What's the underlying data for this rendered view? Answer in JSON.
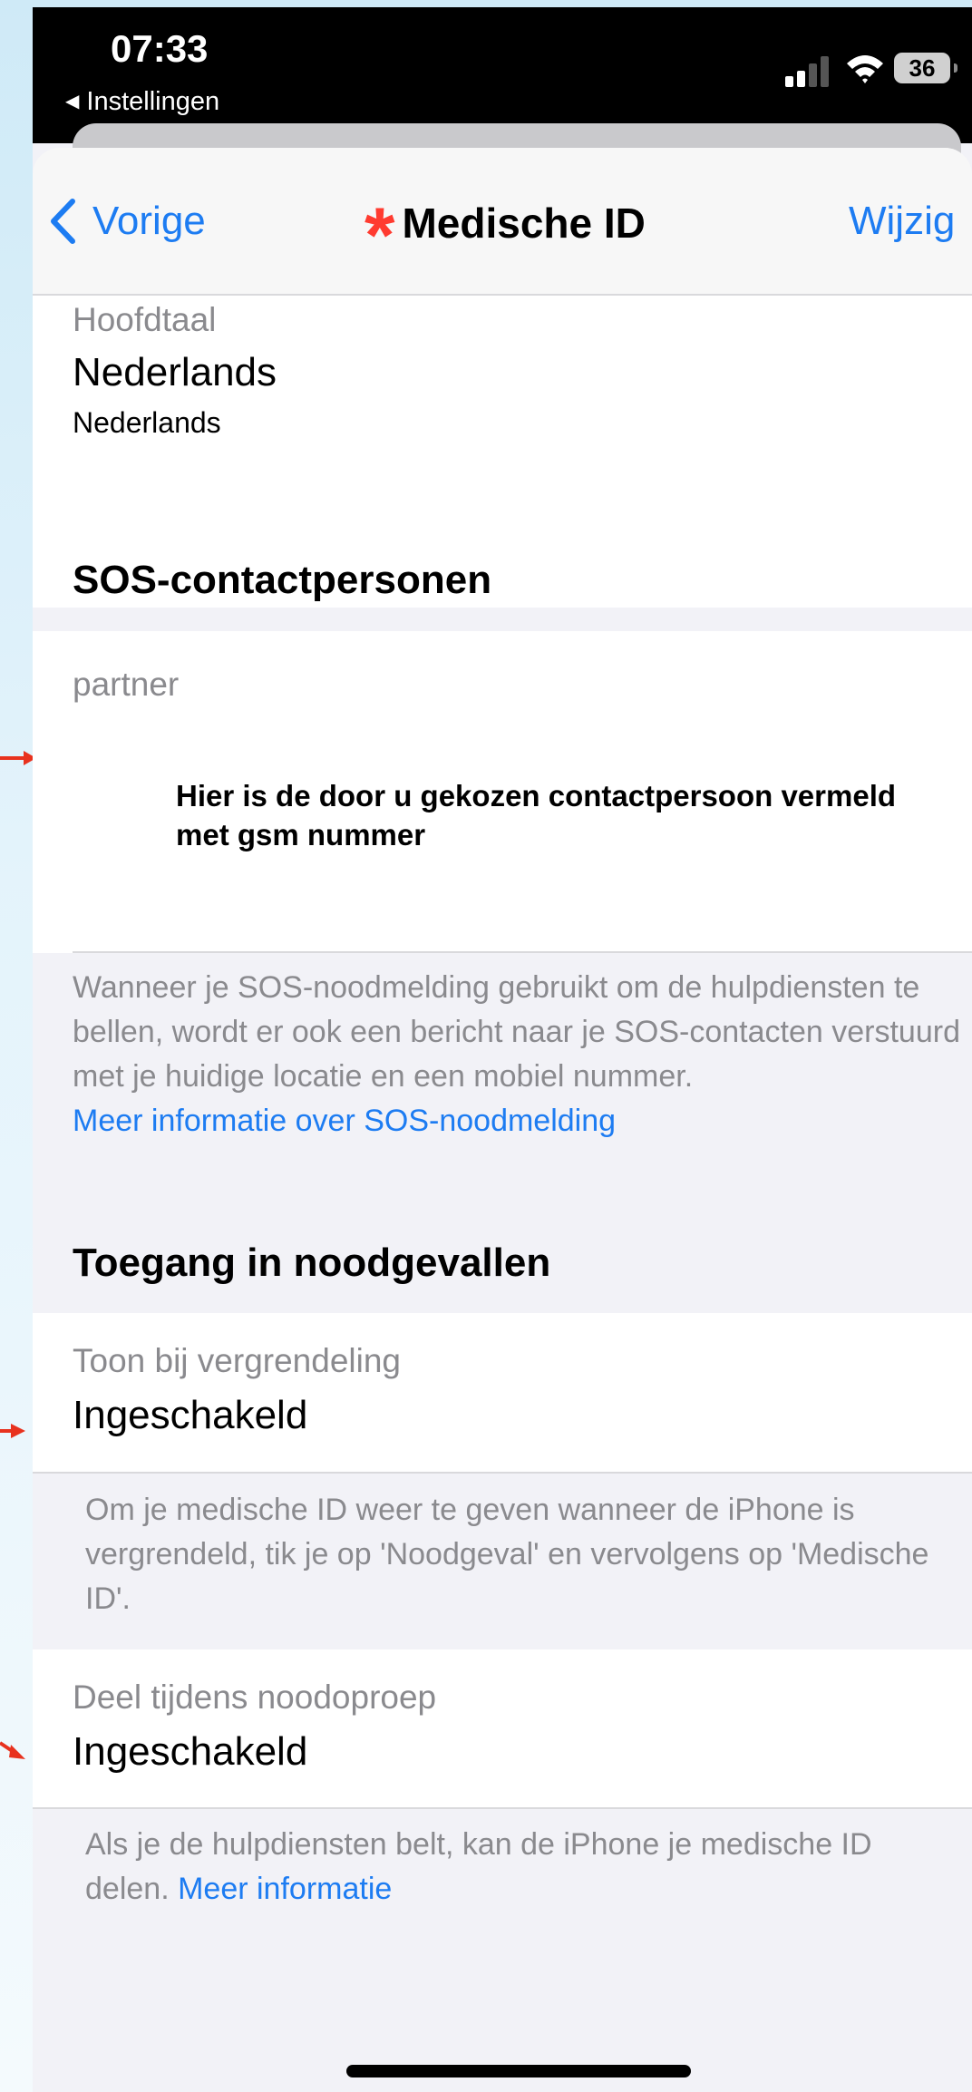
{
  "status_bar": {
    "time": "07:33",
    "back_app": "Instellingen",
    "battery": "36"
  },
  "nav": {
    "back_label": "Vorige",
    "title": "Medische ID",
    "edit_label": "Wijzig"
  },
  "language": {
    "label": "Hoofdtaal",
    "value": "Nederlands",
    "subvalue": "Nederlands"
  },
  "sos": {
    "header": "SOS-contactpersonen",
    "contact_relation": "partner",
    "annotation": "Hier is de door u gekozen contactpersoon vermeld met gsm nummer",
    "footer_text": "Wanneer je SOS-noodmelding gebruikt om de hulpdiensten te bellen, wordt er ook een bericht naar je SOS-contacten verstuurd met je huidige locatie en een mobiel nummer.",
    "footer_link": "Meer informatie over SOS-noodmelding"
  },
  "emergency_access": {
    "header": "Toegang in noodgevallen",
    "lock_label": "Toon bij vergrendeling",
    "lock_value": "Ingeschakeld",
    "lock_footer": "Om je medische ID weer te geven wanneer de iPhone is vergrendeld, tik je op 'Noodgeval' en vervolgens op 'Medische ID'.",
    "share_label": "Deel tijdens noodoproep",
    "share_value": "Ingeschakeld",
    "share_footer": "Als je de hulpdiensten belt, kan de iPhone je medische ID delen.",
    "share_footer_link": "Meer informatie"
  },
  "colors": {
    "accent": "#1d7cf2",
    "asterisk": "#ff3b30",
    "annotation_arrow": "#e8321e"
  }
}
